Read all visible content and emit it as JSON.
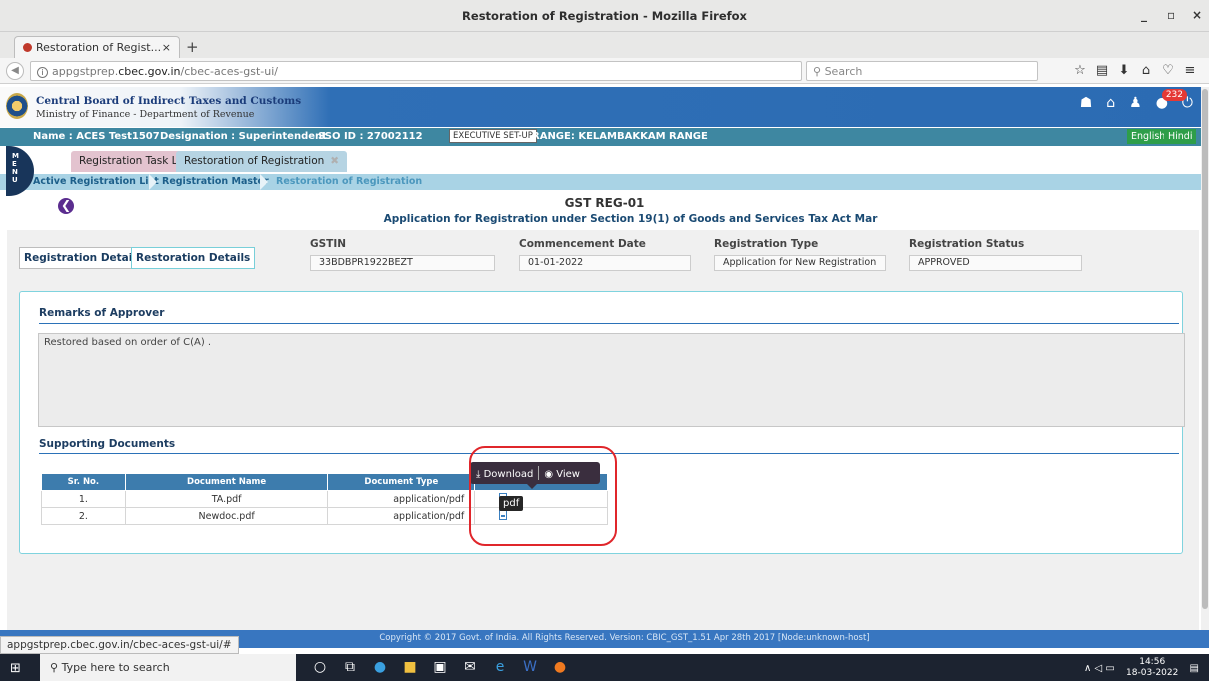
{
  "window": {
    "title": "Restoration of Registration - Mozilla Firefox",
    "minimize": "_",
    "maximize": "▫",
    "close": "×"
  },
  "browser": {
    "tab_title": "Restoration of Regist...",
    "tab_close": "×",
    "new_tab": "+",
    "url_prefix": "appgstprep.",
    "url_domain": "cbec.gov.in",
    "url_path": "/cbec-aces-gst-ui/",
    "reload": "C",
    "search_placeholder": "Search",
    "icons": [
      "star-icon",
      "reading-list-icon",
      "download-icon",
      "home-icon",
      "pocket-icon",
      "menu-icon"
    ]
  },
  "header": {
    "org_name": "Central Board of Indirect Taxes and Customs",
    "org_sub": "Ministry of Finance - Department of Revenue",
    "notification_count": "232"
  },
  "infobar": {
    "name": "Name : ACES Test1507",
    "designation": "Designation : Superintendent",
    "sso": "SSO ID : 27002112",
    "exec_button": "EXECUTIVE SET-UP",
    "range": "RANGE: KELAMBAKKAM RANGE",
    "lang_en": "English",
    "lang_hi": "Hindi"
  },
  "menu": {
    "letters": "M\nE\nN\nU"
  },
  "page_tabs": {
    "tab1": "Registration Task List",
    "tab2": "Restoration of Registration",
    "tab2_close": "✖"
  },
  "breadcrumb": {
    "c1": "Active Registration List",
    "c2": "Registration Master",
    "c3": "Restoration of Registration"
  },
  "page": {
    "back": "❮",
    "title": "GST REG-01",
    "subtitle": "Application for Registration under Section 19(1) of Goods and Services Tax Act Mar"
  },
  "details": {
    "tab_registration": "Registration Details",
    "tab_restoration": "Restoration Details",
    "gstin_label": "GSTIN",
    "gstin": "33BDBPR1922BEZT",
    "commencement_label": "Commencement Date",
    "commencement": "01-01-2022",
    "reg_type_label": "Registration Type",
    "reg_type": "Application for New Registration",
    "reg_status_label": "Registration Status",
    "reg_status": "APPROVED"
  },
  "remarks": {
    "title": "Remarks of Approver",
    "text": "Restored based on order of C(A) ."
  },
  "documents": {
    "title": "Supporting Documents",
    "headers": [
      "Sr. No.",
      "Document Name",
      "Document Type",
      ""
    ],
    "rows": [
      {
        "sr": "1.",
        "name": "TA.pdf",
        "type": "application/pdf"
      },
      {
        "sr": "2.",
        "name": "Newdoc.pdf",
        "type": "application/pdf"
      }
    ],
    "tooltip_download": "Download",
    "tooltip_view": "View",
    "pdf_tip": "pdf"
  },
  "footer": {
    "copyright": "Copyright © 2017 Govt. of India. All Rights Reserved. Version: CBIC_GST_1.51 Apr 28th 2017    [Node:unknown-host]",
    "status_url": "appgstprep.cbec.gov.in/cbec-aces-gst-ui/#"
  },
  "taskbar": {
    "search_placeholder": "Type here to search",
    "time": "14:56",
    "date": "18-03-2022"
  },
  "colors": {
    "header_blue": "#2b6bb3",
    "infobar": "#3e87a1",
    "highlight_red": "#e0262b"
  }
}
